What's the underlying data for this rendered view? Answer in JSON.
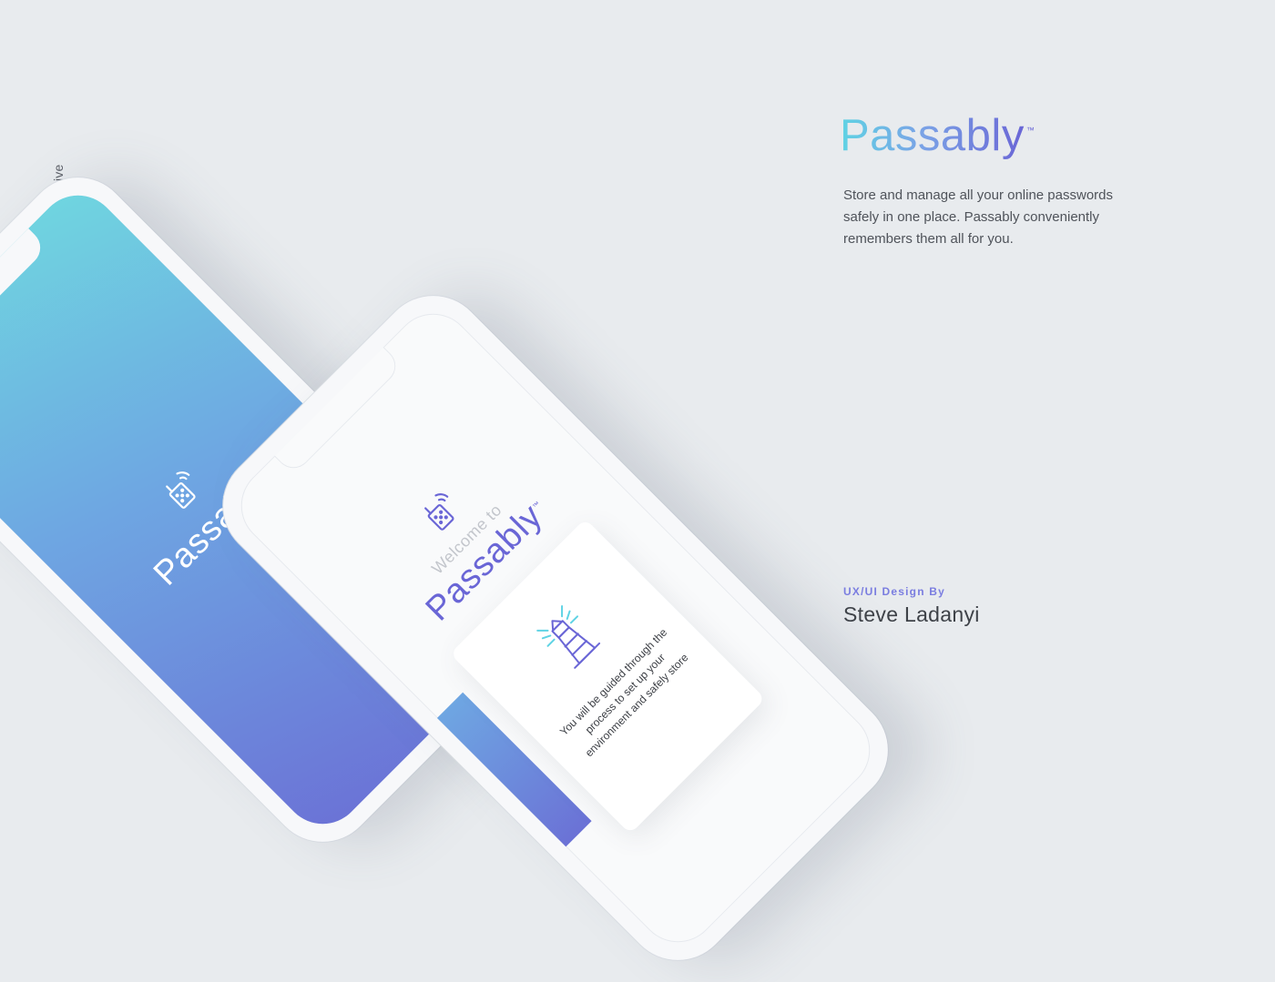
{
  "side_tag": {
    "text": "iOS Exclusive",
    "accent_color": "#6c6fd8"
  },
  "brand": {
    "name": "Passably",
    "trademark": "™",
    "gradient_colors": [
      "#5fd3e4",
      "#7aa2e6",
      "#6a66d6"
    ]
  },
  "description": "Store and manage all your online passwords safely in one place. Passably conveniently remembers them all for you.",
  "credit": {
    "label": "UX/UI Design By",
    "name": "Steve Ladanyi"
  },
  "phone_splash": {
    "logo": "Passably",
    "trademark": "™",
    "icon": "walkie-talkie-icon"
  },
  "phone_welcome": {
    "welcome_text": "Welcome to",
    "logo": "Passably",
    "trademark": "™",
    "icon": "walkie-talkie-icon",
    "card_icon": "lighthouse-icon",
    "card_text": "You will be guided through the process to set up your environment and safely store"
  }
}
